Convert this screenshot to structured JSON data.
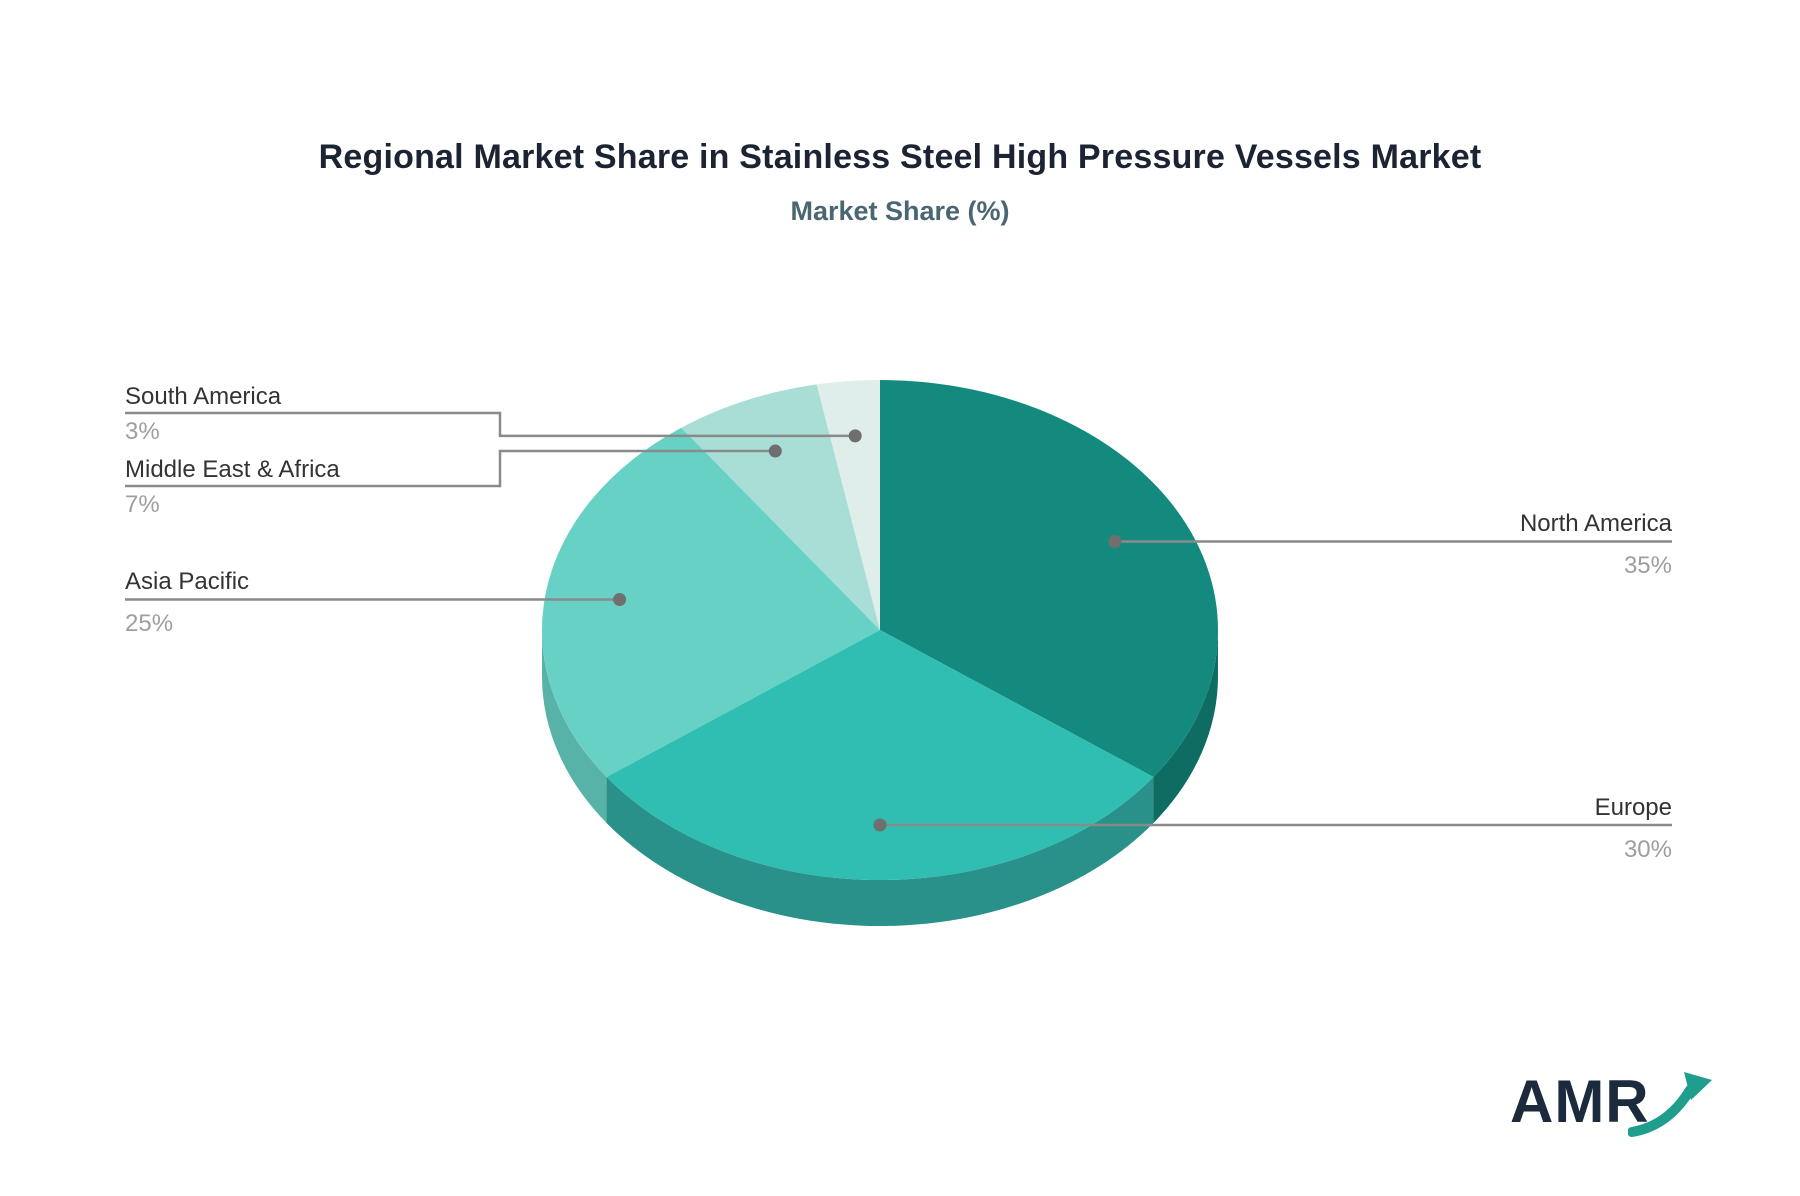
{
  "title": "Regional Market Share in Stainless Steel High Pressure Vessels Market",
  "subtitle": "Market Share (%)",
  "logo": {
    "text": "AMR"
  },
  "colors": {
    "background": "#ffffff",
    "title": "#1c2433",
    "subtitle": "#4a6672",
    "label_name": "#333333",
    "label_value": "#9e9e9e",
    "leader_line": "#8a8a8a",
    "leader_dot": "#6f6f6f",
    "logo_text": "#1b2a3c",
    "logo_arrow": "#1f9e8e"
  },
  "chart_data": {
    "type": "pie",
    "three_d": true,
    "direction": "clockwise",
    "start_angle_deg": 0,
    "title": "Regional Market Share in Stainless Steel High Pressure Vessels Market",
    "subtitle": "Market Share (%)",
    "unit": "%",
    "labels": [
      "North America",
      "Europe",
      "Asia Pacific",
      "Middle East & Africa",
      "South America"
    ],
    "values": [
      35,
      30,
      25,
      7,
      3
    ],
    "display_values": [
      "35%",
      "30%",
      "25%",
      "7%",
      "3%"
    ],
    "slice_colors": [
      "#148a7e",
      "#2fbeb1",
      "#66d1c4",
      "#a9ded7",
      "#dfedeb"
    ],
    "rim_colors": [
      "#0f6c62",
      "#299189",
      "#57b3a7",
      "#8fc7bf",
      "#c4ddd9"
    ],
    "legend": "none"
  }
}
